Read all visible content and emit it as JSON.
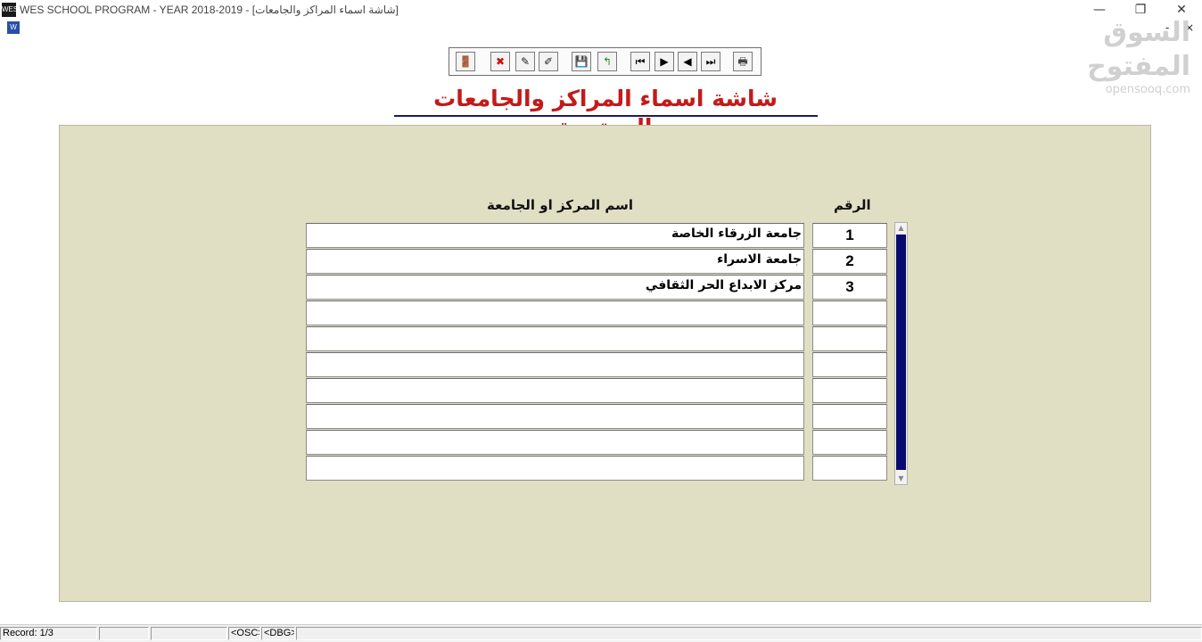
{
  "window": {
    "title": "WES SCHOOL PROGRAM - YEAR 2018-2019 - [شاشة اسماء المراكز والجامعات]",
    "app_icon": "app-icon",
    "minimize_glyph": "—",
    "restore_glyph": "❐",
    "close_glyph": "✕"
  },
  "watermark": {
    "arabic": "السوق المفتوح",
    "latin": "opensooq.com"
  },
  "mdi": {
    "minimize_glyph": "-",
    "close_glyph": "×"
  },
  "toolbar": {
    "buttons": [
      {
        "icon": "exit-door-icon",
        "glyph": "🚪",
        "color": "#1a7a9a"
      },
      {
        "icon": "delete-x-icon",
        "glyph": "✖",
        "color": "#d01010"
      },
      {
        "icon": "edit-wand-icon",
        "glyph": "✎",
        "color": "#222222"
      },
      {
        "icon": "query-wand-icon",
        "glyph": "✐",
        "color": "#222222"
      },
      {
        "icon": "save-disk-icon",
        "glyph": "💾",
        "color": "#1a1a1a"
      },
      {
        "icon": "new-record-icon",
        "glyph": "↰",
        "color": "#2a8a2a"
      },
      {
        "icon": "first-record-icon",
        "glyph": "⏮",
        "color": "#000000"
      },
      {
        "icon": "next-record-icon",
        "glyph": "▶",
        "color": "#000000"
      },
      {
        "icon": "previous-record-icon",
        "glyph": "◀",
        "color": "#000000"
      },
      {
        "icon": "last-record-icon",
        "glyph": "⏭",
        "color": "#000000"
      },
      {
        "icon": "print-icon",
        "glyph": "🖶",
        "color": "#444444"
      }
    ]
  },
  "page": {
    "title": "شاشة اسماء المراكز والجامعات المعتمدة",
    "title_color": "#c41a1a"
  },
  "table": {
    "headers": {
      "number": "الرقم",
      "name": "اسم المركز او الجامعة"
    },
    "rows": [
      {
        "number": "1",
        "name": "جامعة الزرقاء الخاصة"
      },
      {
        "number": "2",
        "name": "جامعة الاسراء"
      },
      {
        "number": "3",
        "name": "مركز الابداع الحر الثقافي"
      },
      {
        "number": "",
        "name": ""
      },
      {
        "number": "",
        "name": ""
      },
      {
        "number": "",
        "name": ""
      },
      {
        "number": "",
        "name": ""
      },
      {
        "number": "",
        "name": ""
      },
      {
        "number": "",
        "name": ""
      },
      {
        "number": "",
        "name": ""
      }
    ]
  },
  "scrollbar": {
    "up_glyph": "▲",
    "down_glyph": "▼",
    "thumb_color": "#0a0a6e"
  },
  "statusbar": {
    "record": "Record: 1/3",
    "seg2": "",
    "seg3": "",
    "osc": "<OSC>",
    "dbg": "<DBG>",
    "seg6": ""
  }
}
